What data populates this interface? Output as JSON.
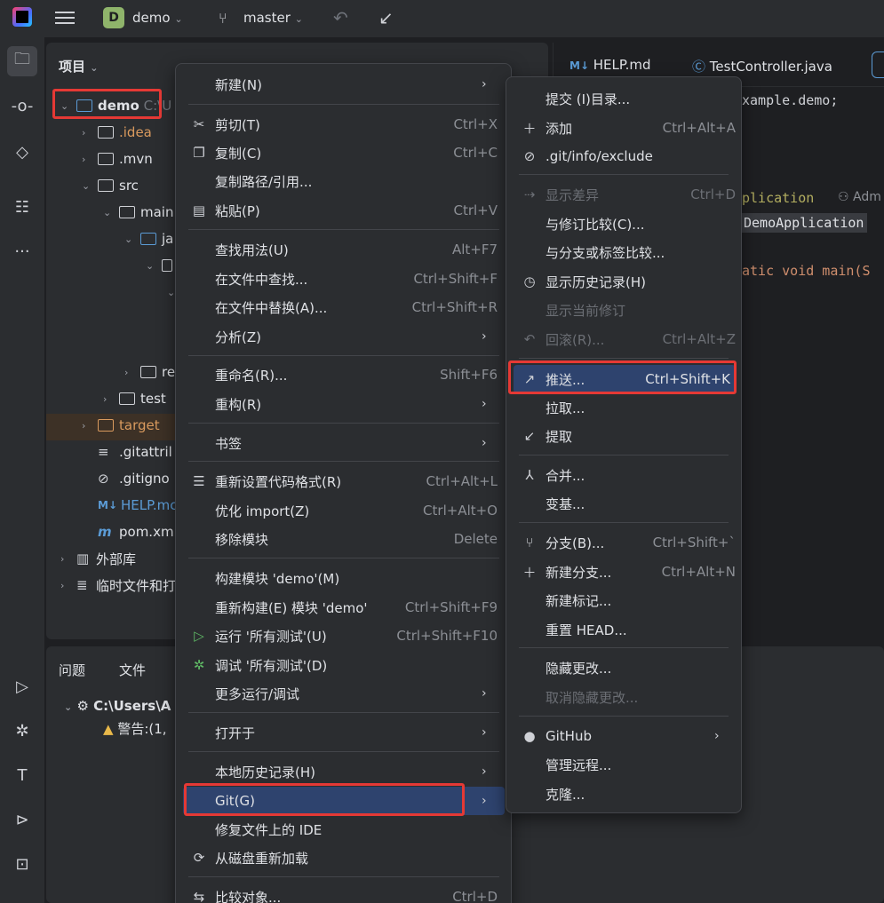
{
  "titlebar": {
    "project_badge": "D",
    "project_name": "demo",
    "branch": "master"
  },
  "project_panel": {
    "title": "项目",
    "tree": [
      {
        "label": "demo",
        "suffix": "C:\\U"
      },
      {
        "label": ".idea"
      },
      {
        "label": ".mvn"
      },
      {
        "label": "src"
      },
      {
        "label": "main"
      },
      {
        "label": "ja"
      },
      {
        "label": "re"
      },
      {
        "label": "test"
      },
      {
        "label": "target"
      },
      {
        "label": ".gitattril"
      },
      {
        "label": ".gitigno"
      },
      {
        "label": "HELP.mc"
      },
      {
        "label": "pom.xm"
      },
      {
        "label": "外部库"
      },
      {
        "label": "临时文件和打"
      }
    ]
  },
  "editor": {
    "tabs": [
      "HELP.md",
      "TestController.java"
    ],
    "code_lines": [
      "xample.demo;",
      "plication",
      "Adm",
      "DemoApplication",
      "atic void main(S"
    ]
  },
  "bottom_panel": {
    "tabs": [
      "问题",
      "文件"
    ],
    "path": "C:\\Users\\A",
    "warning": "警告:(1,"
  },
  "context_menu": {
    "items": [
      {
        "label": "新建(N)",
        "shortcut": ""
      },
      {
        "label": "剪切(T)",
        "shortcut": "Ctrl+X"
      },
      {
        "label": "复制(C)",
        "shortcut": "Ctrl+C"
      },
      {
        "label": "复制路径/引用...",
        "shortcut": ""
      },
      {
        "label": "粘贴(P)",
        "shortcut": "Ctrl+V"
      },
      {
        "label": "查找用法(U)",
        "shortcut": "Alt+F7"
      },
      {
        "label": "在文件中查找...",
        "shortcut": "Ctrl+Shift+F"
      },
      {
        "label": "在文件中替换(A)...",
        "shortcut": "Ctrl+Shift+R"
      },
      {
        "label": "分析(Z)",
        "shortcut": ""
      },
      {
        "label": "重命名(R)...",
        "shortcut": "Shift+F6"
      },
      {
        "label": "重构(R)",
        "shortcut": ""
      },
      {
        "label": "书签",
        "shortcut": ""
      },
      {
        "label": "重新设置代码格式(R)",
        "shortcut": "Ctrl+Alt+L"
      },
      {
        "label": "优化 import(Z)",
        "shortcut": "Ctrl+Alt+O"
      },
      {
        "label": "移除模块",
        "shortcut": "Delete"
      },
      {
        "label": "构建模块 'demo'(M)",
        "shortcut": ""
      },
      {
        "label": "重新构建(E) 模块 'demo'",
        "shortcut": "Ctrl+Shift+F9"
      },
      {
        "label": "运行 '所有测试'(U)",
        "shortcut": "Ctrl+Shift+F10"
      },
      {
        "label": "调试 '所有测试'(D)",
        "shortcut": ""
      },
      {
        "label": "更多运行/调试",
        "shortcut": ""
      },
      {
        "label": "打开于",
        "shortcut": ""
      },
      {
        "label": "本地历史记录(H)",
        "shortcut": ""
      },
      {
        "label": "Git(G)",
        "shortcut": ""
      },
      {
        "label": "修复文件上的 IDE",
        "shortcut": ""
      },
      {
        "label": "从磁盘重新加载",
        "shortcut": ""
      },
      {
        "label": "比较对象...",
        "shortcut": "Ctrl+D"
      }
    ]
  },
  "git_menu": {
    "items": [
      {
        "label": "提交 (I)目录...",
        "shortcut": ""
      },
      {
        "label": "添加",
        "shortcut": "Ctrl+Alt+A"
      },
      {
        "label": ".git/info/exclude",
        "shortcut": ""
      },
      {
        "label": "显示差异",
        "shortcut": "Ctrl+D"
      },
      {
        "label": "与修订比较(C)...",
        "shortcut": ""
      },
      {
        "label": "与分支或标签比较...",
        "shortcut": ""
      },
      {
        "label": "显示历史记录(H)",
        "shortcut": ""
      },
      {
        "label": "显示当前修订",
        "shortcut": ""
      },
      {
        "label": "回滚(R)...",
        "shortcut": "Ctrl+Alt+Z"
      },
      {
        "label": "推送...",
        "shortcut": "Ctrl+Shift+K"
      },
      {
        "label": "拉取...",
        "shortcut": ""
      },
      {
        "label": "提取",
        "shortcut": ""
      },
      {
        "label": "合并...",
        "shortcut": ""
      },
      {
        "label": "变基...",
        "shortcut": ""
      },
      {
        "label": "分支(B)...",
        "shortcut": "Ctrl+Shift+`"
      },
      {
        "label": "新建分支...",
        "shortcut": "Ctrl+Alt+N"
      },
      {
        "label": "新建标记...",
        "shortcut": ""
      },
      {
        "label": "重置 HEAD...",
        "shortcut": ""
      },
      {
        "label": "隐藏更改...",
        "shortcut": ""
      },
      {
        "label": "取消隐藏更改...",
        "shortcut": ""
      },
      {
        "label": "GitHub",
        "shortcut": ""
      },
      {
        "label": "管理远程...",
        "shortcut": ""
      },
      {
        "label": "克隆...",
        "shortcut": ""
      }
    ]
  }
}
